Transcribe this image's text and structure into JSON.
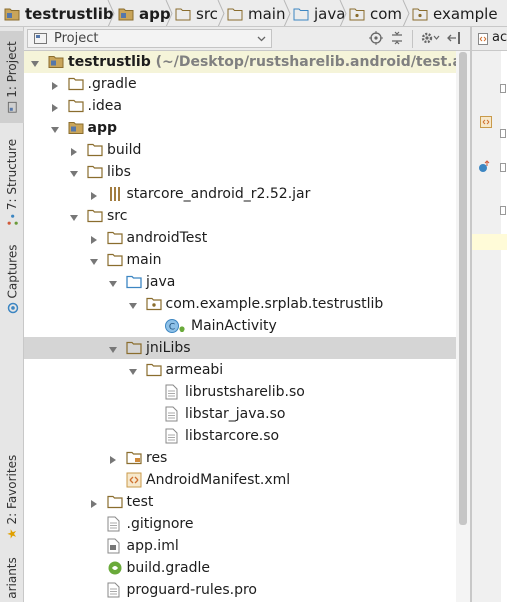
{
  "breadcrumb": {
    "items": [
      {
        "label": "testrustlib",
        "bold": true
      },
      {
        "label": "app",
        "bold": true
      },
      {
        "label": "src",
        "bold": false
      },
      {
        "label": "main",
        "bold": false
      },
      {
        "label": "java",
        "bold": false
      },
      {
        "label": "com",
        "bold": false
      },
      {
        "label": "example",
        "bold": false
      }
    ]
  },
  "left_toolbar": {
    "project_tab": "1: Project",
    "structure_tab": "7: Structure",
    "captures_tab": "Captures",
    "favorites_tab": "2: Favorites",
    "variants_tab": "ariants"
  },
  "panel": {
    "view_selector": "Project"
  },
  "editor_tab": {
    "label": "ac"
  },
  "tree": [
    {
      "label": "testrustlib",
      "path": " (~/Desktop/rustsharelib.android/test.android",
      "bold": true,
      "icon": "module-folder-icon"
    },
    {
      "label": ".gradle",
      "icon": "folder-icon"
    },
    {
      "label": ".idea",
      "icon": "folder-icon"
    },
    {
      "label": "app",
      "bold": true,
      "icon": "module-folder-icon"
    },
    {
      "label": "build",
      "icon": "folder-icon"
    },
    {
      "label": "libs",
      "icon": "folder-icon"
    },
    {
      "label": "starcore_android_r2.52.jar",
      "icon": "jar-icon"
    },
    {
      "label": "src",
      "icon": "folder-icon"
    },
    {
      "label": "androidTest",
      "icon": "folder-icon"
    },
    {
      "label": "main",
      "icon": "folder-icon"
    },
    {
      "label": "java",
      "icon": "source-folder-icon"
    },
    {
      "label": "com.example.srplab.testrustlib",
      "icon": "package-icon"
    },
    {
      "label": "MainActivity",
      "icon": "class-icon"
    },
    {
      "label": "jniLibs",
      "icon": "folder-icon"
    },
    {
      "label": "armeabi",
      "icon": "folder-icon"
    },
    {
      "label": "librustsharelib.so",
      "icon": "file-icon"
    },
    {
      "label": "libstar_java.so",
      "icon": "file-icon"
    },
    {
      "label": "libstarcore.so",
      "icon": "file-icon"
    },
    {
      "label": "res",
      "icon": "resource-folder-icon"
    },
    {
      "label": "AndroidManifest.xml",
      "icon": "manifest-icon"
    },
    {
      "label": "test",
      "icon": "folder-icon"
    },
    {
      "label": ".gitignore",
      "icon": "file-icon"
    },
    {
      "label": "app.iml",
      "icon": "iml-file-icon"
    },
    {
      "label": "build.gradle",
      "icon": "gradle-icon"
    },
    {
      "label": "proguard-rules.pro",
      "icon": "file-icon"
    }
  ],
  "colors": {
    "folder": "#c9a55a",
    "source_folder": "#5aa3d6",
    "highlight": "#f5f4d9",
    "selected": "#d5d5d5"
  }
}
